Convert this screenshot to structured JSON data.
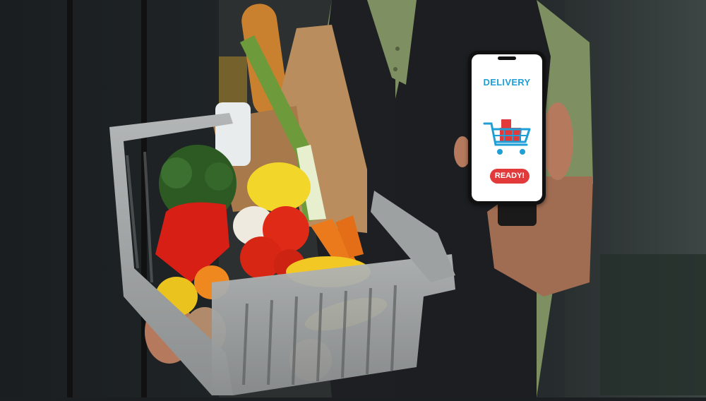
{
  "phone_screen": {
    "title": "DELIVERY",
    "badge": "READY!",
    "icon": "shopping-cart-icon",
    "colors": {
      "title": "#1f9fd6",
      "badge": "#e23a3a",
      "cart_outline": "#1f9fd6",
      "cart_boxes": "#e23a3a"
    }
  }
}
